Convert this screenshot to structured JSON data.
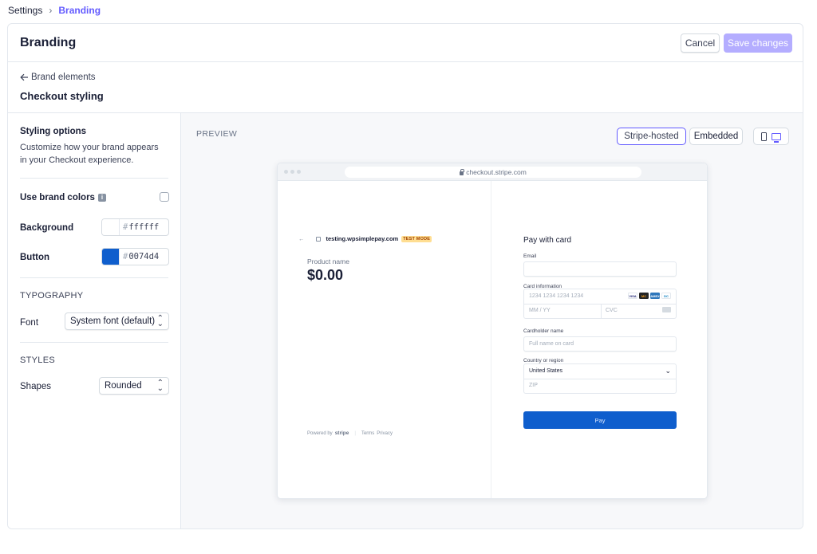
{
  "breadcrumb": {
    "parent": "Settings",
    "separator": "›",
    "current": "Branding"
  },
  "header": {
    "title": "Branding",
    "cancel_label": "Cancel",
    "save_label": "Save changes"
  },
  "subheader": {
    "back_label": "Brand elements",
    "title": "Checkout styling"
  },
  "styling": {
    "title": "Styling options",
    "description": "Customize how your brand appears in your Checkout experience.",
    "use_brand_colors_label": "Use brand colors",
    "use_brand_colors_checked": false,
    "background_label": "Background",
    "background_hex": "ffffff",
    "background_color": "#ffffff",
    "button_label": "Button",
    "button_hex": "0074d4",
    "button_color": "#0f5ecd",
    "typography_heading": "TYPOGRAPHY",
    "font_label": "Font",
    "font_value": "System font (default)",
    "styles_heading": "STYLES",
    "shapes_label": "Shapes",
    "shapes_value": "Rounded"
  },
  "preview": {
    "label": "PREVIEW",
    "toggle_hosted": "Stripe-hosted",
    "toggle_embedded": "Embedded",
    "url": "checkout.stripe.com",
    "merchant": "testing.wpsimplepay.com",
    "test_mode": "TEST MODE",
    "product_name": "Product name",
    "price": "$0.00",
    "powered_by": "Powered by",
    "stripe_word": "stripe",
    "terms": "Terms",
    "privacy": "Privacy",
    "pay_title": "Pay with card",
    "email_label": "Email",
    "card_info_label": "Card information",
    "card_number_placeholder": "1234 1234 1234 1234",
    "expiry_placeholder": "MM / YY",
    "cvc_placeholder": "CVC",
    "cardholder_label": "Cardholder name",
    "cardholder_placeholder": "Full name on card",
    "country_label": "Country or region",
    "country_value": "United States",
    "zip_placeholder": "ZIP",
    "pay_label": "Pay",
    "brands": [
      "VISA",
      "MC",
      "AMEX",
      "DC"
    ]
  },
  "colors": {
    "accent": "#635bff",
    "pay_button": "#0f5ecd"
  }
}
